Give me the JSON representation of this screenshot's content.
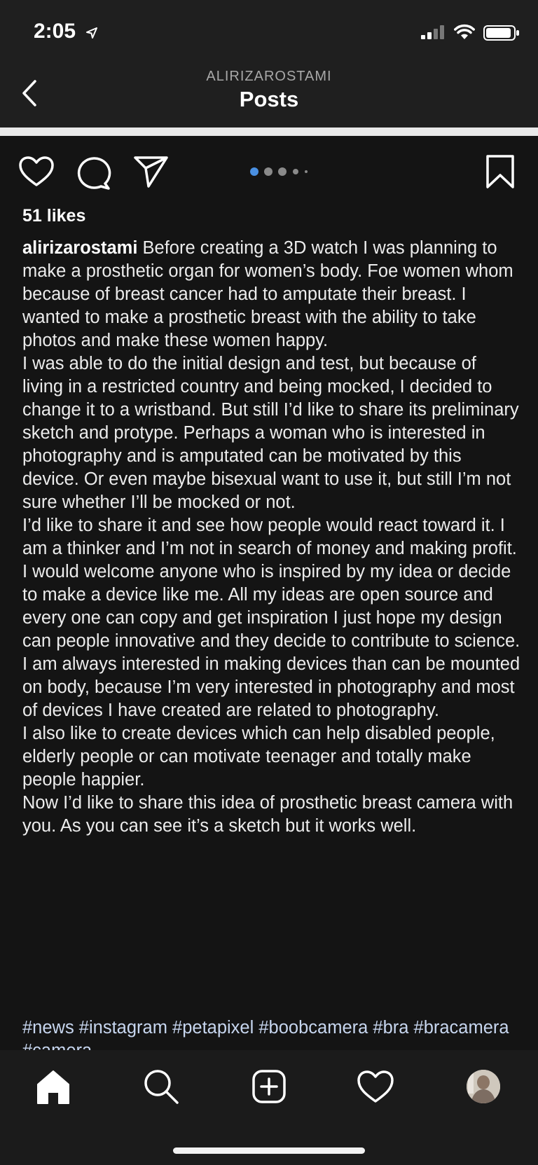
{
  "status_bar": {
    "time": "2:05"
  },
  "header": {
    "username": "ALIRIZAROSTAMI",
    "title": "Posts"
  },
  "post": {
    "likes": "51 likes",
    "carousel": {
      "total": 5,
      "current": 1
    },
    "caption_user": "alirizarostami",
    "caption_paragraphs": [
      "Before creating a 3D watch I was planning to make a prosthetic organ for women’s body. Foe women whom because of breast cancer had to amputate their breast.  I wanted to make a prosthetic breast with the ability to take photos and make these women happy.",
      "I was able to do the initial design and test, but because of living in a restricted country and being mocked, I decided to change it to a wristband.  But still I’d like to share its preliminary sketch and protype. Perhaps a woman who is interested in photography and is amputated can be motivated by this device.  Or even maybe bisexual want to use it, but still I’m not sure whether I’ll be mocked or not.",
      "I’d like to share it and see how people would react toward it. I am a thinker and I’m not in search of money and making profit. I would welcome anyone who is inspired by my idea or decide to make a device like me.  All my ideas are open source and every one can copy and get inspiration I just hope my design can people innovative and they decide to contribute to science.",
      "I am always interested in making devices than can be mounted on body, because I’m very interested in photography and most of devices I have created are related to photography.",
      "I also like to create devices which can help disabled people, elderly people or can motivate teenager and totally make people happier.",
      "Now I’d like to share this idea of prosthetic breast camera with you.  As you can see it’s a sketch but it works well."
    ],
    "hashtags": "#news #instagram #petapixel #boobcamera #bra #bracamera #camera"
  },
  "icons": {
    "like": "heart-icon",
    "comment": "speech-bubble-icon",
    "share": "paper-plane-icon",
    "save": "bookmark-icon",
    "home": "home-icon",
    "search": "search-icon",
    "new_post": "plus-square-icon",
    "activity": "heart-icon",
    "profile": "avatar"
  },
  "colors": {
    "background": "#141414",
    "bar": "#1f1f1f",
    "hashtag": "#c7d6ef",
    "active_dot": "#4a90e2"
  }
}
